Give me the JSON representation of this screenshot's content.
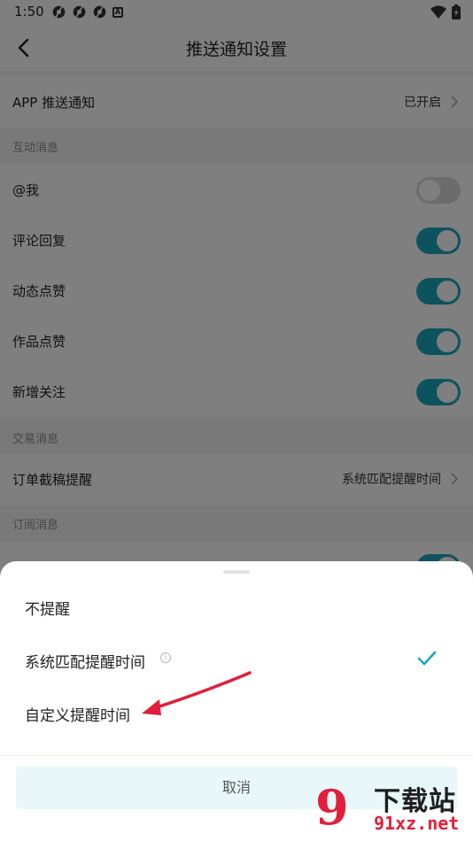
{
  "status_bar": {
    "time": "1:50",
    "badge_letter": "A"
  },
  "header": {
    "title": "推送通知设置"
  },
  "app_push": {
    "label": "APP 推送通知",
    "value": "已开启"
  },
  "sections": {
    "interaction": "互动消息",
    "trade": "交易消息",
    "subscribe": "订阅消息"
  },
  "toggles": [
    {
      "label": "@我",
      "on": false
    },
    {
      "label": "评论回复",
      "on": true
    },
    {
      "label": "动态点赞",
      "on": true
    },
    {
      "label": "作品点赞",
      "on": true
    },
    {
      "label": "新增关注",
      "on": true
    }
  ],
  "order_reminder": {
    "label": "订单截稿提醒",
    "value": "系统匹配提醒时间"
  },
  "sheet": {
    "options": [
      {
        "label": "不提醒",
        "selected": false
      },
      {
        "label": "系统匹配提醒时间",
        "selected": true
      },
      {
        "label": "自定义提醒时间",
        "selected": false
      }
    ],
    "info_glyph": "i",
    "cancel_label": "取消"
  },
  "watermark": {
    "digits": "9",
    "text": "下载站",
    "url": "91xz.net"
  },
  "colors": {
    "accent": "#1aa6bd",
    "annotation": "#e21f3a"
  }
}
